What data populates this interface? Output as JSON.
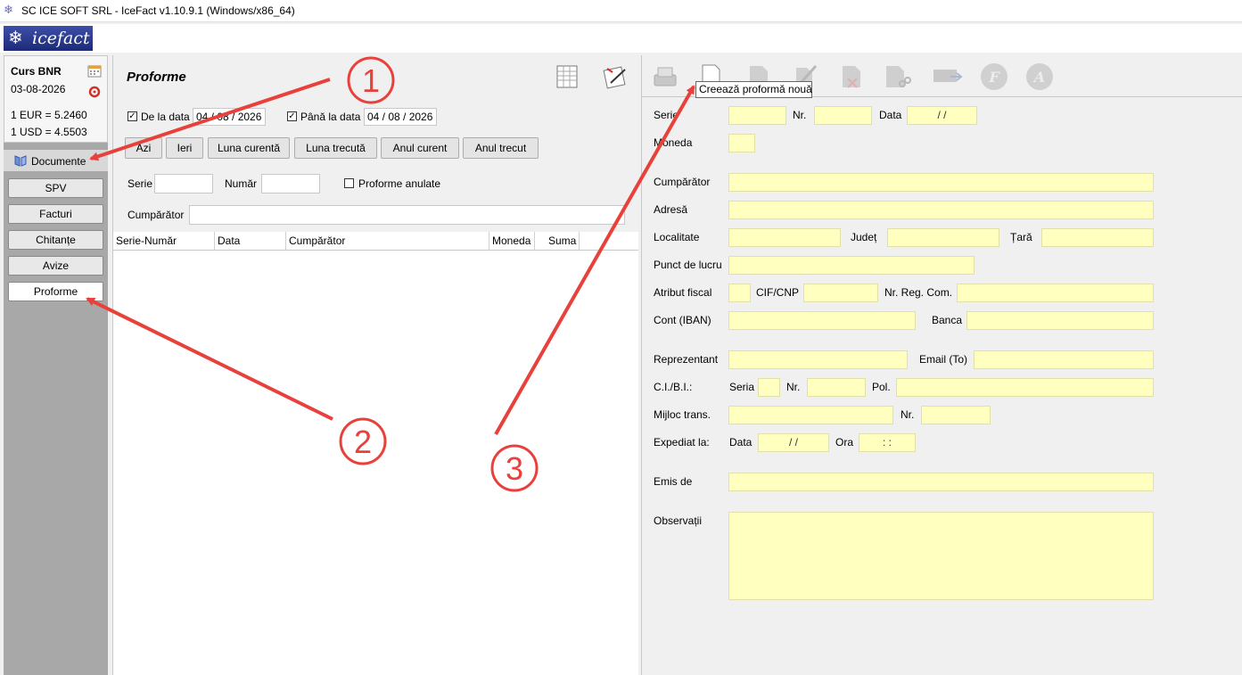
{
  "window": {
    "title": "SC ICE SOFT SRL - IceFact v1.10.9.1 (Windows/x86_64)"
  },
  "logo": {
    "text": "icefact"
  },
  "bnr": {
    "title": "Curs BNR",
    "date": "03-08-2026",
    "eur": "1 EUR  =  5.2460",
    "usd": "1 USD  =  4.5503"
  },
  "sidebar": {
    "tab_label": "Documente",
    "items": [
      {
        "label": "SPV"
      },
      {
        "label": "Facturi"
      },
      {
        "label": "Chitanțe"
      },
      {
        "label": "Avize"
      },
      {
        "label": "Proforme"
      }
    ]
  },
  "list": {
    "title": "Proforme",
    "from_label": "De la data",
    "from_value": "04 / 08 / 2026",
    "to_label": "Până la data",
    "to_value": "04 / 08 / 2026",
    "buttons": [
      "Azi",
      "Ieri",
      "Luna curentă",
      "Luna trecută",
      "Anul curent",
      "Anul trecut"
    ],
    "serie_label": "Serie",
    "numar_label": "Număr",
    "anulate_label": "Proforme anulate",
    "cumparator_label": "Cumpărător",
    "columns": [
      "Serie-Număr",
      "Data",
      "Cumpărător",
      "Moneda",
      "Suma"
    ]
  },
  "form": {
    "tooltip": "Creează proformă nouă",
    "serie": "Serie",
    "nr": "Nr.",
    "data": "Data",
    "date_value": "/      /",
    "moneda": "Moneda",
    "cumparator": "Cumpărător",
    "adresa": "Adresă",
    "localitate": "Localitate",
    "judet": "Județ",
    "tara": "Țară",
    "punct": "Punct de lucru",
    "atribut": "Atribut fiscal",
    "cif": "CIF/CNP",
    "nrreg": "Nr. Reg. Com.",
    "cont": "Cont (IBAN)",
    "banca": "Banca",
    "reprezentant": "Reprezentant",
    "email": "Email (To)",
    "ci": "C.I./B.I.:",
    "ci_seria": "Seria",
    "ci_nr": "Nr.",
    "pol": "Pol.",
    "mijloc": "Mijloc trans.",
    "mijloc_nr": "Nr.",
    "expediat": "Expediat la:",
    "exp_data": "Data",
    "exp_date_value": "/      /",
    "exp_ora": "Ora",
    "exp_ora_value": ":      :",
    "emis": "Emis de",
    "observatii": "Observații"
  },
  "annotations": {
    "one": "1",
    "two": "2",
    "three": "3"
  },
  "colors": {
    "field_yellow": "#ffffc0",
    "arrow_red": "#e8413c",
    "logo_blue": "#2a3a8c"
  }
}
